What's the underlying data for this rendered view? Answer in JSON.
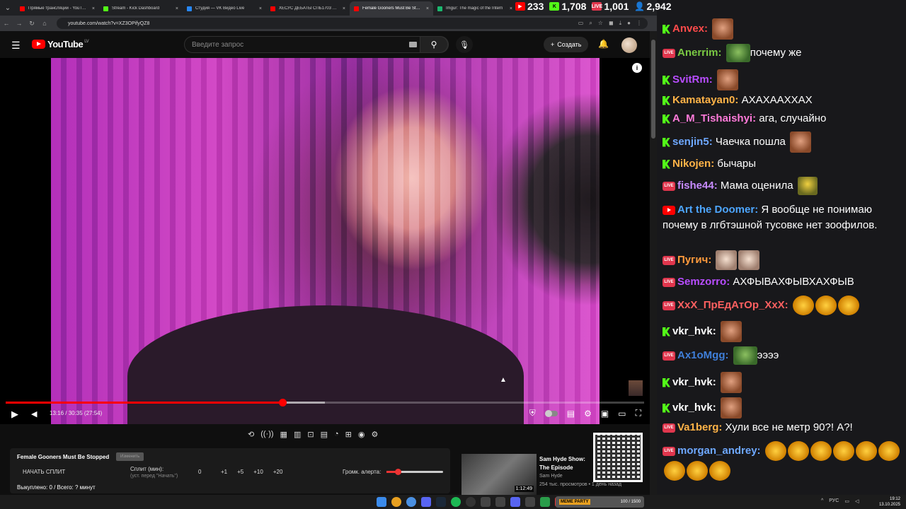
{
  "browser": {
    "tabs": [
      {
        "title": "Прямые трансляции - YouTube",
        "color": "#ff0000"
      },
      {
        "title": "Stream - Kick Dashboard",
        "color": "#53fc18"
      },
      {
        "title": "Студия — VK Видео Live",
        "color": "#2787f5"
      },
      {
        "title": "ХЕСУС ДЕБАТЫ СПБ1703 И М",
        "color": "#ff0000"
      },
      {
        "title": "Female Gooners Must Be Stopp",
        "color": "#ff0000",
        "active": true
      },
      {
        "title": "Imgur: The magic of the Intern",
        "color": "#1bb76e"
      }
    ],
    "url": "youtube.com/watch?v=XZ3OPifyQZ8"
  },
  "stats": {
    "youtube": "233",
    "kick": "1,708",
    "vk": "1,001",
    "total": "2,942"
  },
  "youtube": {
    "logo_text": "YouTube",
    "logo_region": "LV",
    "search_placeholder": "Введите запрос",
    "create_label": "Создать",
    "time": "13:16 / 30:35 (27:54)",
    "progress_fraction": 0.434,
    "buffered_fraction": 0.5,
    "icons": {
      "menu": "menu-icon",
      "search": "search-icon",
      "mic": "mic-icon",
      "bell": "bell-icon",
      "info": "info-icon",
      "play": "play-icon",
      "volume": "volume-icon",
      "settings": "gear-icon",
      "fullscreen": "fullscreen-icon"
    }
  },
  "panel": {
    "title": "Female Gooners Must Be Stopped",
    "badge": "Изменить",
    "start": "НАЧАТЬ СПЛИТ",
    "split_label": "Сплит (мин):",
    "split_hint": "(уст. перед \"Начать\")",
    "zero": "0",
    "increments": [
      "+1",
      "+5",
      "+10",
      "+20"
    ],
    "alert_label": "Громк. алерта:",
    "alert_level": 0.2,
    "bought": "Выкуплено: 0 / Всего: ? минут"
  },
  "recommended": {
    "title": "Sam Hyde Show: The Episode",
    "channel": "Sam Hyde",
    "meta": "254 тыс. просмотров • 1 день назад",
    "duration": "1:12:49"
  },
  "chat": [
    {
      "platform": "kick",
      "nick": "Anvex",
      "color": "#ff4b4b",
      "text": "",
      "emotes": [
        "face"
      ]
    },
    {
      "platform": "vk",
      "nick": "Anerrim",
      "color": "#7ac943",
      "text": "почему же",
      "emotes_before": [
        "frog"
      ]
    },
    {
      "platform": "kick",
      "nick": "SvitRm",
      "color": "#b84dff",
      "text": "",
      "emotes": [
        "face"
      ]
    },
    {
      "platform": "kick",
      "nick": "Kamatayan0",
      "color": "#ffb347",
      "text": "АХАХААХХАХ"
    },
    {
      "platform": "kick",
      "nick": "A_M_Tishaishyi",
      "color": "#ff7ad9",
      "text": "ага, случайно"
    },
    {
      "platform": "kick",
      "nick": "senjin5",
      "color": "#6ea8ff",
      "text": "Чаечка пошла",
      "emotes": [
        "face"
      ]
    },
    {
      "platform": "kick",
      "nick": "Nikojen",
      "color": "#ffb347",
      "text": "бычары"
    },
    {
      "platform": "vk",
      "nick": "fishe44",
      "color": "#c78bff",
      "text": "Мама оценила",
      "emotes": [
        "duck"
      ]
    },
    {
      "platform": "youtube",
      "nick": "Art the Doomer",
      "color": "#4da6ff",
      "text": "Я вообще не понимаю почему в лгбтэшной тусовке нет зоофилов."
    },
    {
      "platform": "vk",
      "nick": "Пугич",
      "color": "#ff9a3c",
      "text": "",
      "emotes": [
        "cat",
        "cat"
      ]
    },
    {
      "platform": "vk",
      "nick": "Semzorro",
      "color": "#b84dff",
      "text": "АХФЫВАХФЫВХАХФЫВ"
    },
    {
      "platform": "vk",
      "nick": "XxX_ПрЕдАтОр_XxX",
      "color": "#ff6060",
      "text": "",
      "emotes": [
        "cry",
        "cry",
        "cry"
      ]
    },
    {
      "platform": "kick",
      "nick": "vkr_hvk",
      "color": "#ffffff",
      "text": "",
      "emotes": [
        "face"
      ]
    },
    {
      "platform": "vk",
      "nick": "Ax1oMgg",
      "color": "#3f7fd9",
      "text": "ээээ",
      "emotes_before": [
        "frog"
      ]
    },
    {
      "platform": "kick",
      "nick": "vkr_hvk",
      "color": "#ffffff",
      "text": "",
      "emotes": [
        "face"
      ]
    },
    {
      "platform": "kick",
      "nick": "vkr_hvk",
      "color": "#ffffff",
      "text": "",
      "emotes": [
        "face"
      ]
    },
    {
      "platform": "vk",
      "nick": "Va1berg",
      "color": "#ffb347",
      "text": "Хули все не метр 90?! А?!"
    },
    {
      "platform": "vk",
      "nick": "morgan_andrey",
      "color": "#6ea8ff",
      "text": "",
      "emotes": [
        "cry",
        "cry",
        "cry",
        "cry",
        "cry",
        "cry",
        "cry",
        "cry",
        "cry"
      ]
    }
  ],
  "taskbar": {
    "widget_text": "100 / 1500",
    "widget_tag": "MEME PARTY",
    "lang": "РУС",
    "time": "19:12",
    "date": "13.10.2025"
  }
}
